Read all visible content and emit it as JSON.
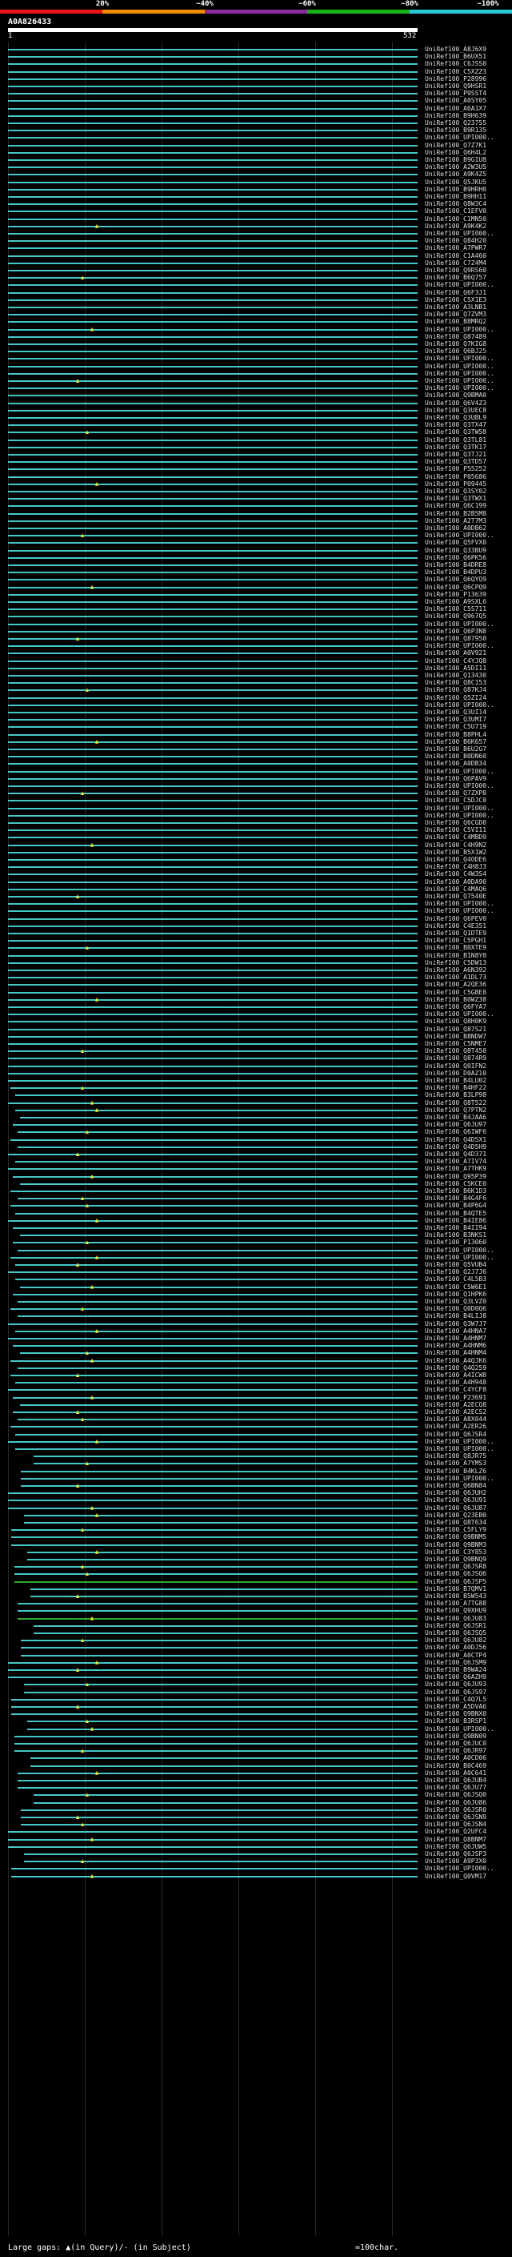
{
  "colors": {
    "background": "#000000",
    "identity_bands": [
      "#e8141c",
      "#f08c00",
      "#8c2ca0",
      "#18b418",
      "#28c8d8"
    ],
    "hit_high": "#46c8c8",
    "hit_mid": "#30a830",
    "gap": "#fff200"
  },
  "scale": {
    "labels": [
      "20%",
      "~40%",
      "~60%",
      "~80%",
      "~100%"
    ]
  },
  "query": {
    "id": "A0A826433",
    "start": "1",
    "end": "532"
  },
  "legend": {
    "gaps_text": "Large gaps: ▲(in Query)/- (in Subject)",
    "scale_text": "=100char."
  },
  "hits": [
    "UniRef100_A8J6X9",
    "UniRef100_B6UX51",
    "UniRef100_C6JSS0",
    "UniRef100_C5XZZ3",
    "UniRef100_P28996",
    "UniRef100_Q9HSR1",
    "UniRef100_P9SST4",
    "UniRef100_A0SY05",
    "UniRef100_A6A1X7",
    "UniRef100_B9H639",
    "UniRef100_Q23755",
    "UniRef100_B9R135",
    "UniRef100_UPI000..",
    "UniRef100_Q7Z7K1",
    "UniRef100_Q6H4L2",
    "UniRef100_B9GIU8",
    "UniRef100_A2W3U5",
    "UniRef100_A9K4Z5",
    "UniRef100_Q5JKU5",
    "UniRef100_B9HRH0",
    "UniRef100_B9HH11",
    "UniRef100_Q8W3C4",
    "UniRef100_C1EFV0",
    "UniRef100_C1MN50",
    "UniRef100_A9K4K2",
    "UniRef100_UPI000..",
    "UniRef100_Q84H20",
    "UniRef100_A7PWR7",
    "UniRef100_C1A460",
    "UniRef100_C7Z4M4",
    "UniRef100_Q9RS60",
    "UniRef100_B6Q757",
    "UniRef100_UPI000..",
    "UniRef100_Q6F3J1",
    "UniRef100_C5X1E3",
    "UniRef100_A3LNB1",
    "UniRef100_Q7ZVM3",
    "UniRef100_B8MRQ2",
    "UniRef100_UPI000..",
    "UniRef100_Q87489",
    "UniRef100_Q7KIG8",
    "UniRef100_Q6BJ25",
    "UniRef100_UPI000..",
    "UniRef100_UPI000..",
    "UniRef100_UPI000..",
    "UniRef100_UPI000..",
    "UniRef100_UPI000..",
    "UniRef100_Q9BMA0",
    "UniRef100_Q6V4Z3",
    "UniRef100_Q3UEC8",
    "UniRef100_Q3UBL9",
    "UniRef100_Q3TX47",
    "UniRef100_Q3TW58",
    "UniRef100_Q3TL81",
    "UniRef100_Q3TK17",
    "UniRef100_Q3TJ21",
    "UniRef100_Q3TD57",
    "UniRef100_P55252",
    "UniRef100_P05686",
    "UniRef100_P09445",
    "UniRef100_Q3SY02",
    "UniRef100_Q3TWX1",
    "UniRef100_Q6C199",
    "UniRef100_B2B5M8",
    "UniRef100_A2T7M3",
    "UniRef100_A0DB62",
    "UniRef100_UPI000..",
    "UniRef100_Q5FVX0",
    "UniRef100_Q33BU9",
    "UniRef100_Q6PK56",
    "UniRef100_B4DRE8",
    "UniRef100_B4DPU3",
    "UniRef100_Q6QYQ9",
    "UniRef100_Q6CPQ9",
    "UniRef100_P13639",
    "UniRef100_A9SXL6",
    "UniRef100_C5S711",
    "UniRef100_Q967Q5",
    "UniRef100_UPI000..",
    "UniRef100_Q6P3N8",
    "UniRef100_Q87950",
    "UniRef100_UPI000..",
    "UniRef100_A0V921",
    "UniRef100_C4YJQ8",
    "UniRef100_A5DI11",
    "UniRef100_Q13430",
    "UniRef100_Q8C153",
    "UniRef100_Q87KJ4",
    "UniRef100_Q5ZI24",
    "UniRef100_UPI000..",
    "UniRef100_Q3UI14",
    "UniRef100_Q3UMI7",
    "UniRef100_C5U719",
    "UniRef100_B8PHL4",
    "UniRef100_B6K657",
    "UniRef100_B6U2G7",
    "UniRef100_B0DN60",
    "UniRef100_A0DB34",
    "UniRef100_UPI000..",
    "UniRef100_Q6PAV9",
    "UniRef100_UPI000..",
    "UniRef100_Q7ZXP8",
    "UniRef100_C5DJC0",
    "UniRef100_UPI000..",
    "UniRef100_UPI000..",
    "UniRef100_Q6CGD0",
    "UniRef100_C5VI11",
    "UniRef100_C4MBD9",
    "UniRef100_C4H9N2",
    "UniRef100_B5X1W2",
    "UniRef100_Q4ODE6",
    "UniRef100_C4H8J3",
    "UniRef100_C4W3S4",
    "UniRef100_A0DA90",
    "UniRef100_C4MAQ6",
    "UniRef100_Q7540E",
    "UniRef100_UPI000..",
    "UniRef100_UPI000..",
    "UniRef100_Q6PEV0",
    "UniRef100_C4E351",
    "UniRef100_Q1DTE9",
    "UniRef100_C5PGH1",
    "UniRef100_B0XTE9",
    "UniRef100_B1N8Y0",
    "UniRef100_C5DW13",
    "UniRef100_A6N392",
    "UniRef100_A1DL73",
    "UniRef100_A2QE36",
    "UniRef100_C5GBE8",
    "UniRef100_B0WZ38",
    "UniRef100_Q6FYA7",
    "UniRef100_UPI000..",
    "UniRef100_Q8H0K9",
    "UniRef100_Q87S21",
    "UniRef100_B8NDW7",
    "UniRef100_C5NME7",
    "UniRef100_Q8T450",
    "UniRef100_Q874R9",
    "UniRef100_Q0IFN2",
    "UniRef100_D0AZ10",
    "UniRef100_B4LU02",
    "UniRef100_B4HF22",
    "UniRef100_B3LP98",
    "UniRef100_Q8T522",
    "UniRef100_Q7PTN2",
    "UniRef100_B4JAA6",
    "UniRef100_Q6JU97",
    "UniRef100_Q6IWF6",
    "UniRef100_Q4D5X1",
    "UniRef100_Q4D5H9",
    "UniRef100_Q4D371",
    "UniRef100_A7IV74",
    "UniRef100_A7THK9",
    "UniRef100_Q95P39",
    "UniRef100_C5KCE0",
    "UniRef100_B6K1D3",
    "UniRef100_B4G4F6",
    "UniRef100_B4P6G4",
    "UniRef100_B4QTE5",
    "UniRef100_B4IE86",
    "UniRef100_B4II94",
    "UniRef100_B3NKS1",
    "UniRef100_P13060",
    "UniRef100_UPI000..",
    "UniRef100_UPI000..",
    "UniRef100_Q5VUB4",
    "UniRef100_Q2J7J6",
    "UniRef100_C4L5B3",
    "UniRef100_C5W6E1",
    "UniRef100_Q1HPK6",
    "UniRef100_Q3LVZ0",
    "UniRef100_Q0D0Q6",
    "UniRef100_B4LIJ8",
    "UniRef100_Q3W7J7",
    "UniRef100_A4HNA7",
    "UniRef100_A4HNM7",
    "UniRef100_A4HNM6",
    "UniRef100_A4HNM4",
    "UniRef100_A4QJK6",
    "UniRef100_Q4Q259",
    "UniRef100_A4ICW8",
    "UniRef100_A4H948",
    "UniRef100_C4YCF8",
    "UniRef100_P23691",
    "UniRef100_A2ECQ8",
    "UniRef100_A2ECS2",
    "UniRef100_A8X044",
    "UniRef100_A2ER26",
    "UniRef100_Q6JSR4",
    "UniRef100_UPI000..",
    "UniRef100_UPI000..",
    "UniRef100_Q8JR75",
    "UniRef100_A7YMS3",
    "UniRef100_B4KLZ6",
    "UniRef100_UPI000..",
    "UniRef100_Q6BN84",
    "UniRef100_Q6JUH2",
    "UniRef100_Q6JU91",
    "UniRef100_Q6JU87",
    "UniRef100_Q23EB0",
    "UniRef100_Q8T634",
    "UniRef100_C5FLY9",
    "UniRef100_Q9BNM5",
    "UniRef100_Q9BNM3",
    "UniRef100_C3Y853",
    "UniRef100_Q9BNQ9",
    "UniRef100_Q6JSR8",
    "UniRef100_Q6JSQ6",
    "UniRef100_Q6JSP5",
    "UniRef100_B7QMV1",
    "UniRef100_B5W543",
    "UniRef100_A7TG88",
    "UniRef100_Q9XHU9",
    "UniRef100_Q6JU83",
    "UniRef100_Q6JSR1",
    "UniRef100_Q6JSQ5",
    "UniRef100_Q6JU82",
    "UniRef100_A0DJ56",
    "UniRef100_A0CTP4",
    "UniRef100_Q6JSM9",
    "UniRef100_B9WA24",
    "UniRef100_Q6AZH9",
    "UniRef100_Q6JU93",
    "UniRef100_Q6JS97",
    "UniRef100_C4Q7L5",
    "UniRef100_A5DVA6",
    "UniRef100_Q9BNX0",
    "UniRef100_B3RSP1",
    "UniRef100_UPI000..",
    "UniRef100_Q9BN09",
    "UniRef100_Q6JUC0",
    "UniRef100_Q6JR97",
    "UniRef100_A0CD06",
    "UniRef100_B0C469",
    "UniRef100_A0C641",
    "UniRef100_Q6JUB4",
    "UniRef100_Q6JU77",
    "UniRef100_Q6JSQ0",
    "UniRef100_Q6JU86",
    "UniRef100_Q6JSR0",
    "UniRef100_Q6JSN9",
    "UniRef100_Q6JSN4",
    "UniRef100_Q2UFC4",
    "UniRef100_Q8BNM7",
    "UniRef100_Q6JUW5",
    "UniRef100_Q6JSP3",
    "UniRef100_A9P3X0",
    "UniRef100_UPI000..",
    "UniRef100_Q0VM17"
  ]
}
